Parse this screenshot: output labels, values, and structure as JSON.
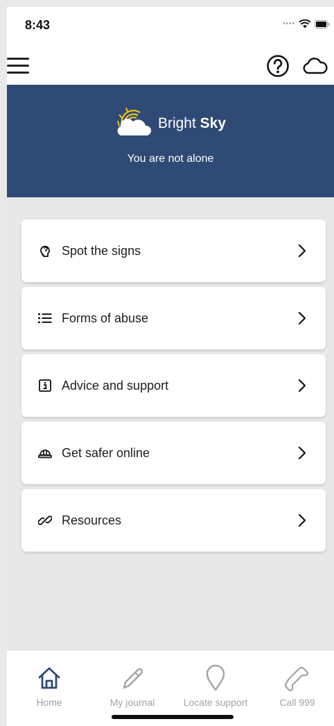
{
  "status_bar": {
    "time": "8:43"
  },
  "banner": {
    "brand_light": "Bright ",
    "brand_bold": "Sky",
    "tagline": "You are not alone"
  },
  "menu": {
    "items": [
      {
        "label": "Spot the signs",
        "icon": "brain-icon"
      },
      {
        "label": "Forms of abuse",
        "icon": "list-icon"
      },
      {
        "label": "Advice and support",
        "icon": "info-icon"
      },
      {
        "label": "Get safer online",
        "icon": "helmet-icon"
      },
      {
        "label": "Resources",
        "icon": "link-icon"
      }
    ]
  },
  "tabs": [
    {
      "label": "Home",
      "icon": "home-icon"
    },
    {
      "label": "My journal",
      "icon": "pencil-icon"
    },
    {
      "label": "Locate support",
      "icon": "location-pin-icon"
    },
    {
      "label": "Call 999",
      "icon": "phone-icon"
    }
  ],
  "colors": {
    "banner": "#2e4a75",
    "logo_sun": "#f2c21a",
    "tab_active": "#2e4a75",
    "tab_inactive": "#a3a3a3"
  }
}
